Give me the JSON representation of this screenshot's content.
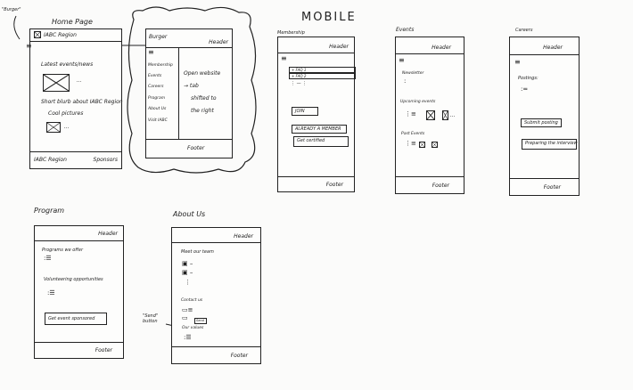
{
  "title": "MOBILE",
  "home": {
    "annotation": "\"Burger\"",
    "title": "Home Page",
    "logo_text": "IABC Region",
    "latest": "Latest events/news",
    "ellipsis": "...",
    "blurb": "Short blurb about IABC Region",
    "pictures": "Cool pictures",
    "footer_left": "IABC Region",
    "footer_right": "Sponsors"
  },
  "burger": {
    "title": "Burger",
    "header": "Header",
    "menu": [
      "Membership",
      "Events",
      "Careers",
      "Program",
      "About Us",
      "Visit IABC"
    ],
    "note": [
      "Open website",
      "→ tab",
      "shifted to",
      "the right"
    ],
    "footer": "Footer"
  },
  "membership": {
    "title": "Membership",
    "header": "Header",
    "rows": [
      "+ FAQ 1",
      "+ FAQ 2"
    ],
    "more": "⋮ — ⋮",
    "buttons": [
      "JOIN",
      "ALREADY A MEMBER",
      "Get certified"
    ],
    "footer": "Footer"
  },
  "events": {
    "title": "Events",
    "header": "Header",
    "newsletter": "Newsletter",
    "upcoming": "Upcoming events",
    "past": "Past Events",
    "ellipsis": "...",
    "footer": "Footer"
  },
  "careers": {
    "title": "Careers",
    "header": "Header",
    "postings": "Postings:",
    "buttons": [
      "Submit posting",
      "Preparing the interview"
    ],
    "footer": "Footer"
  },
  "program": {
    "title": "Program",
    "header": "Header",
    "offer": "Programs we offer",
    "volunteer": "Volunteering opportunities",
    "button": "Get event sponsored",
    "footer": "Footer"
  },
  "about": {
    "title": "About Us",
    "header": "Header",
    "team": "Meet our team",
    "contact": "Contact us",
    "send": "Send",
    "values": "Our values",
    "annotation": "\"Send\" button",
    "footer": "Footer"
  }
}
